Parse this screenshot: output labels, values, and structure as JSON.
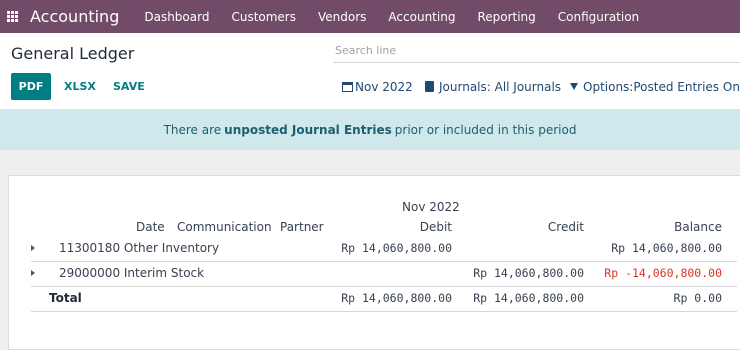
{
  "navbar": {
    "brand": "Accounting",
    "menu": [
      "Dashboard",
      "Customers",
      "Vendors",
      "Accounting",
      "Reporting",
      "Configuration"
    ]
  },
  "page": {
    "title": "General Ledger",
    "search_placeholder": "Search line",
    "buttons": {
      "pdf": "PDF",
      "xlsx": "XLSX",
      "save": "SAVE"
    },
    "filters": {
      "period": "Nov 2022",
      "journals": "Journals: All Journals",
      "options": "Options:Posted Entries Only"
    }
  },
  "alert": {
    "prefix": "There are",
    "bold": "unposted Journal Entries",
    "suffix": "prior or included in this period"
  },
  "report": {
    "period_header": "Nov 2022",
    "columns": {
      "date": "Date",
      "communication": "Communication",
      "partner": "Partner",
      "debit": "Debit",
      "credit": "Credit",
      "balance": "Balance"
    },
    "rows": [
      {
        "account": "11300180 Other Inventory",
        "debit": "Rp 14,060,800.00",
        "credit": "",
        "balance": "Rp 14,060,800.00"
      },
      {
        "account": "29000000 Interim Stock",
        "debit": "",
        "credit": "Rp 14,060,800.00",
        "balance": "Rp -14,060,800.00"
      }
    ],
    "total": {
      "label": "Total",
      "debit": "Rp 14,060,800.00",
      "credit": "Rp 14,060,800.00",
      "balance": "Rp 0.00"
    }
  },
  "colors": {
    "navbar": "#714b67",
    "primary": "#017e84",
    "alert_bg": "#cfe8ec",
    "negative": "#d9362b"
  }
}
